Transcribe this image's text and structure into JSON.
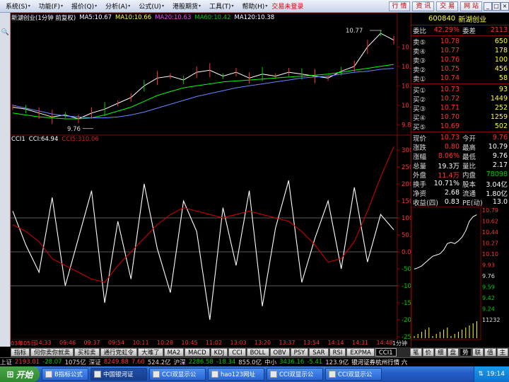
{
  "menu": [
    {
      "label": "系统(S)"
    },
    {
      "label": "功能(F)"
    },
    {
      "label": "报价(Q)"
    },
    {
      "label": "分析(A)"
    },
    {
      "label": "公式(U)"
    },
    {
      "label": "港股期货"
    },
    {
      "label": "工具(T)"
    },
    {
      "label": "帮助(H)"
    }
  ],
  "trade_status": "交易未登录",
  "top_buttons": [
    "行 情",
    "资 讯",
    "交 易",
    "网 站"
  ],
  "legend": {
    "name": "新湖创业(1分钟 前复权)",
    "ma5": "MA5:10.67",
    "ma10": "MA10:10.66",
    "ma20": "MA20:10.63",
    "ma60": "MA60:10.42",
    "ma120": "MA120:10.38"
  },
  "cci_legend": {
    "name": "CCI1",
    "cci": "CCI:64.94",
    "cci5": "CCI5:310.06"
  },
  "price_axis": [
    "10.60",
    "10.40",
    "10.20",
    "10.00",
    "9.80"
  ],
  "cci_axis": [
    "300.0",
    "250.0",
    "200.0",
    "150.0",
    "100.0",
    "50.00",
    "0.00",
    "-50.00",
    "-100.0",
    "-150.0",
    "-200.0",
    "-250.0"
  ],
  "time_axis": [
    "03年05日",
    "14:33",
    "09:46",
    "09:37",
    "09:54",
    "10:11",
    "10:28",
    "10:45",
    "11:02",
    "13:03",
    "13:20",
    "13:37",
    "13:54",
    "14:14",
    "14:31",
    "14:48"
  ],
  "time_period": "1分钟",
  "annotations": {
    "high": "10.77",
    "low": "9.76"
  },
  "chart_data": {
    "type": "line",
    "title": "新湖创业(1分钟 前复权)",
    "series": [
      {
        "name": "MA5",
        "values": [
          9.98,
          9.96,
          9.92,
          9.88,
          9.9,
          9.86,
          9.92,
          9.96,
          10.02,
          10.08,
          10.2,
          10.28,
          10.3,
          10.26,
          10.34,
          10.36,
          10.3,
          10.34,
          10.28,
          10.32,
          10.3,
          10.34,
          10.32,
          10.3,
          10.28,
          10.35,
          10.4,
          10.6,
          10.74,
          10.67
        ]
      },
      {
        "name": "MA60",
        "values": [
          9.92,
          9.9,
          9.88,
          9.87,
          9.86,
          9.86,
          9.87,
          9.9,
          9.94,
          9.98,
          10.04,
          10.1,
          10.14,
          10.18,
          10.2,
          10.22,
          10.24,
          10.25,
          10.26,
          10.27,
          10.28,
          10.29,
          10.3,
          10.31,
          10.32,
          10.34,
          10.36,
          10.38,
          10.4,
          10.42
        ]
      },
      {
        "name": "MA120",
        "values": [
          10.0,
          9.97,
          9.94,
          9.91,
          9.89,
          9.88,
          9.87,
          9.87,
          9.88,
          9.9,
          9.93,
          9.97,
          10.01,
          10.05,
          10.09,
          10.12,
          10.15,
          10.18,
          10.2,
          10.22,
          10.24,
          10.26,
          10.28,
          10.29,
          10.3,
          10.32,
          10.34,
          10.35,
          10.37,
          10.38
        ]
      },
      {
        "name": "CCI",
        "values": [
          120,
          20,
          -60,
          160,
          -100,
          40,
          180,
          -150,
          90,
          -80,
          200,
          10,
          -120,
          150,
          60,
          -200,
          130,
          -40,
          180,
          -160,
          70,
          210,
          -90,
          40,
          150,
          -50,
          190,
          -30,
          110,
          64.94
        ]
      },
      {
        "name": "CCI5",
        "values": [
          80,
          60,
          30,
          -20,
          -40,
          -60,
          -80,
          -90,
          -40,
          0,
          40,
          80,
          110,
          130,
          120,
          110,
          100,
          110,
          120,
          110,
          100,
          90,
          60,
          20,
          -30,
          -20,
          30,
          120,
          220,
          310.06
        ]
      }
    ],
    "ylim": [
      9.7,
      10.85
    ]
  },
  "quote": {
    "code": "600840",
    "name": "新湖创业",
    "weibi_label": "委比",
    "weibi": "42.29%",
    "weicha_label": "委差",
    "weicha": "2113",
    "sell": [
      {
        "l": "卖⑤",
        "p": "10.78",
        "v": "650"
      },
      {
        "l": "卖④",
        "p": "10.77",
        "v": "178"
      },
      {
        "l": "卖③",
        "p": "10.76",
        "v": "100"
      },
      {
        "l": "卖②",
        "p": "10.75",
        "v": "456"
      },
      {
        "l": "卖①",
        "p": "10.74",
        "v": "58"
      }
    ],
    "buy": [
      {
        "l": "买①",
        "p": "10.73",
        "v": "93"
      },
      {
        "l": "买②",
        "p": "10.72",
        "v": "1449"
      },
      {
        "l": "买③",
        "p": "10.71",
        "v": "252"
      },
      {
        "l": "买④",
        "p": "10.70",
        "v": "1259"
      },
      {
        "l": "买⑤",
        "p": "10.69",
        "v": "502"
      }
    ],
    "stats": [
      {
        "l1": "现价",
        "v1": "10.73",
        "l2": "今开",
        "v2": "9.76"
      },
      {
        "l1": "涨跌",
        "v1": "0.80",
        "l2": "最高",
        "v2": "10.79"
      },
      {
        "l1": "涨幅",
        "v1": "8.06%",
        "l2": "最低",
        "v2": "9.76"
      },
      {
        "l1": "总量",
        "v1": "19.3万",
        "l2": "量比",
        "v2": "2.17"
      },
      {
        "l1": "外盘",
        "v1": "11.4万",
        "l2": "内盘",
        "v2": "78098"
      },
      {
        "l1": "换手",
        "v1": "10.71%",
        "l2": "股本",
        "v2": "3.04亿"
      },
      {
        "l1": "净资",
        "v1": "2.68",
        "l2": "流通",
        "v2": "1.80亿"
      },
      {
        "l1": "收益(四)",
        "v1": "0.83",
        "l2": "PE(动)",
        "v2": "13.0"
      }
    ]
  },
  "mini_axis": [
    "10.79",
    "10.62",
    "10.44",
    "10.27",
    "10.10",
    "9.93",
    "9.76",
    "9.59",
    "9.42",
    "9.24",
    "11232"
  ],
  "tabs": [
    "指标",
    "何你卖你就卖",
    "买和卖",
    "通行党虹令",
    "大难了",
    "MA2",
    "MACD",
    "KDJ",
    "CCI",
    "BOLL",
    "OBV",
    "PSY",
    "SAR",
    "RSI",
    "EXPMA",
    "CCI1"
  ],
  "rtabs": [
    "笔",
    "价",
    "细",
    "盘",
    "势",
    "联",
    "值",
    "主"
  ],
  "index_bar": {
    "a": "上证",
    "av": "2193.01",
    "ac": "-28.07",
    "aa": "1075亿",
    "b": "深证",
    "bv": "8249.88",
    "bc": "7.60",
    "ba": "524.2亿",
    "c": "沪深",
    "cv": "2286.58",
    "cc": "-18.34",
    "ca": "855.0亿",
    "d": "中小",
    "dv": "3436.16",
    "dc": "-5.41",
    "da": "123.9亿",
    "e": "银河证券杭州行情 六"
  },
  "taskbar": {
    "start": "开始",
    "items": [
      "B指标公式",
      "中国银河证",
      "CCI双显示公",
      "hao123网址",
      "CCI双显示公",
      "CCI双显示公"
    ],
    "clock": "19:14"
  },
  "colors": {
    "up": "#ff3333",
    "down": "#00cc00",
    "ma5": "#ffffff",
    "ma10": "#ffff33",
    "ma20": "#ff44ff",
    "ma60": "#00ff00",
    "ma120": "#6688ff",
    "cci5": "#cc0000"
  }
}
